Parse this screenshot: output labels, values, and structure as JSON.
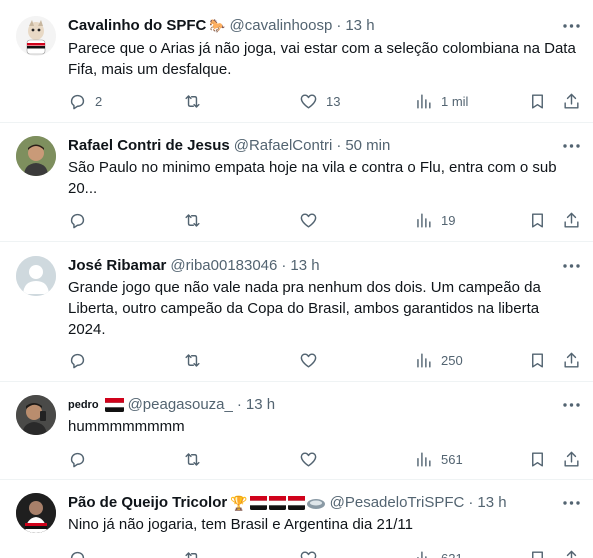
{
  "colors": {
    "text": "#0f1419",
    "secondary": "#536471",
    "divider": "#eff3f4"
  },
  "tweets": [
    {
      "name": "Cavalinho do SPFC",
      "name_emoji": "🐎",
      "handle": "@cavalinhoosp",
      "time": "13 h",
      "text": "Parece que o Arias já não joga, vai estar com a seleção colombiana na Data\nFifa, mais um desfalque.",
      "replies": "2",
      "retweets": "",
      "likes": "13",
      "views": "1 mil"
    },
    {
      "name": "Rafael Contri de Jesus",
      "handle": "@RafaelContri",
      "time": "50 min",
      "text": "São Paulo no minimo empata hoje na vila e contra o Flu, entra com o sub\n20...",
      "replies": "",
      "retweets": "",
      "likes": "",
      "views": "19"
    },
    {
      "name": "José Ribamar",
      "handle": "@riba00183046",
      "time": "13 h",
      "text": "Grande jogo que não vale nada pra nenhum dos dois. Um campeão da\nLiberta, outro campeão da Copa do Brasil, ambos garantidos na liberta\n2024.",
      "replies": "",
      "retweets": "",
      "likes": "",
      "views": "250"
    },
    {
      "name": "pedro",
      "handle": "@peagasouza_",
      "time": "13 h",
      "text": "hummmmmmmm",
      "replies": "",
      "retweets": "",
      "likes": "",
      "views": "561"
    },
    {
      "name": "Pão de Queijo Tricolor",
      "name_emoji": "🏆",
      "handle": "@PesadeloTriSPFC",
      "time": "13 h",
      "text": "Nino já não jogaria, tem Brasil e Argentina dia 21/11",
      "replies": "",
      "retweets": "",
      "likes": "",
      "views": "621"
    }
  ]
}
